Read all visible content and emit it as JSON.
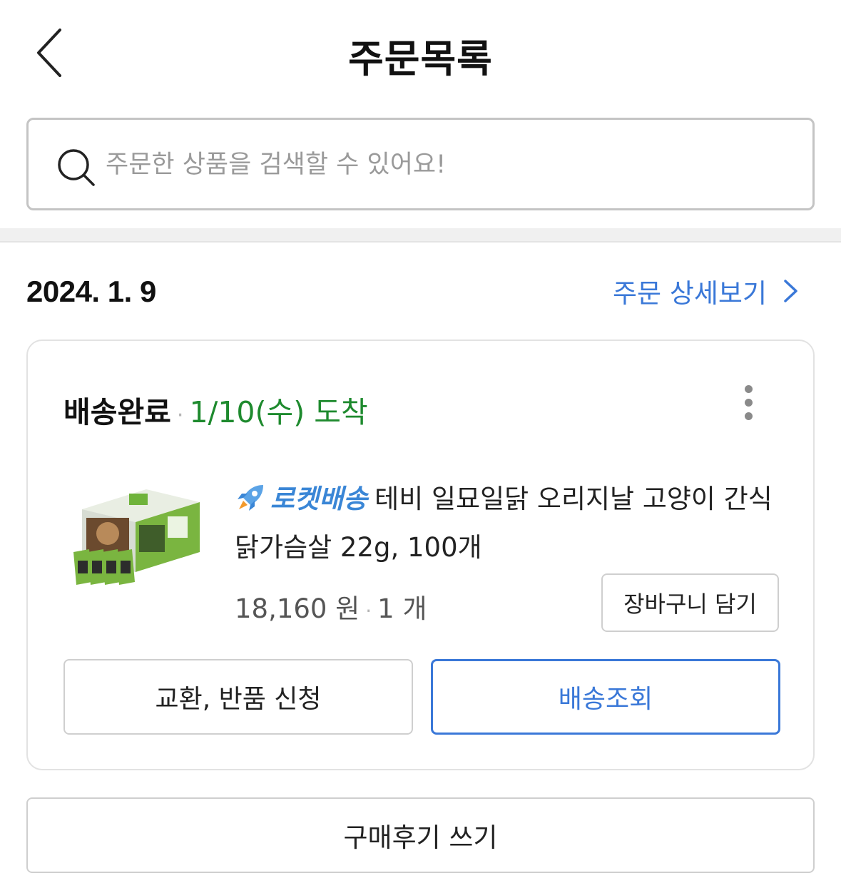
{
  "header": {
    "title": "주문목록",
    "back_icon": "chevron-left-icon"
  },
  "search": {
    "icon": "search-icon",
    "placeholder": "주문한 상품을 검색할 수 있어요!",
    "value": ""
  },
  "order": {
    "date": "2024. 1. 9",
    "detail_link_label": "주문 상세보기",
    "status": "배송완료",
    "status_separator": "·",
    "arrival": "1/10(수) 도착",
    "arrival_color": "#1e8a2e",
    "product": {
      "badge_icon": "rocket-icon",
      "badge_label": "로켓배송",
      "name": "테비 일묘일닭 오리지날 고양이 간식 닭가슴살 22g, 100개",
      "price": "18,160 원",
      "separator": "·",
      "quantity": "1 개",
      "add_to_cart_label": "장바구니 담기"
    },
    "return_button_label": "교환, 반품 신청",
    "track_button_label": "배송조회",
    "accent_color": "#3a78d8"
  },
  "review_button_label": "구매후기 쓰기"
}
